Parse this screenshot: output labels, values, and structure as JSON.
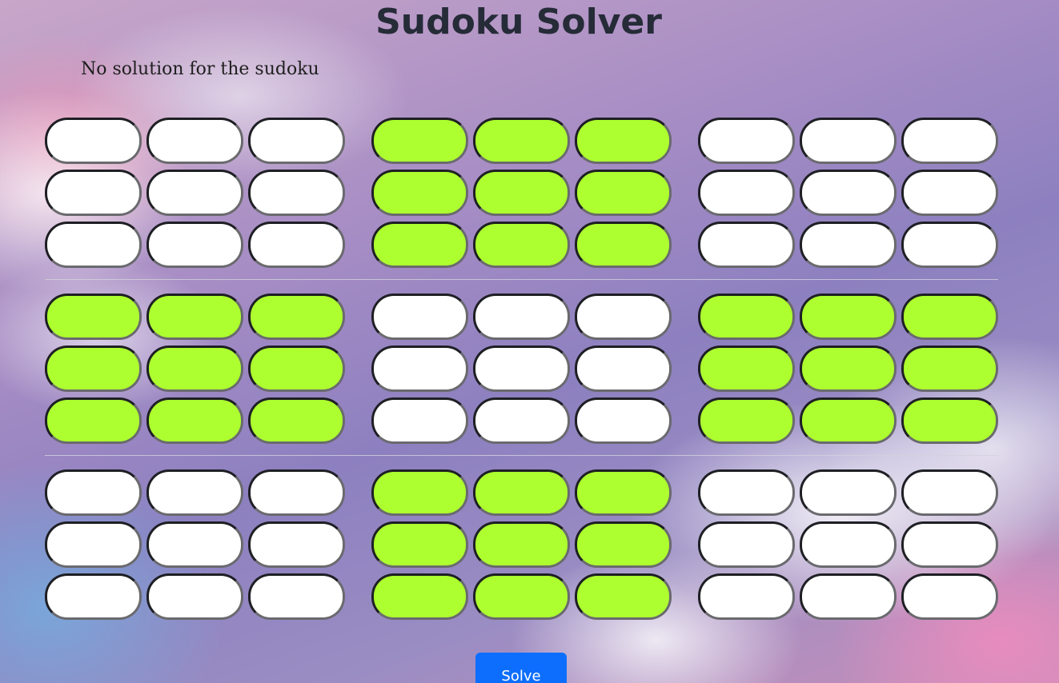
{
  "app": {
    "title": "Sudoku Solver",
    "message": "No solution for the sudoku"
  },
  "grid": {
    "highlight_color": "#adff2f",
    "cell_color": "#ffffff",
    "highlighted_boxes": [
      1,
      3,
      5,
      7
    ],
    "cells": [
      [
        "",
        "",
        "",
        "",
        "",
        "",
        "",
        "",
        ""
      ],
      [
        "",
        "",
        "",
        "",
        "",
        "",
        "",
        "",
        ""
      ],
      [
        "",
        "",
        "",
        "",
        "",
        "",
        "",
        "",
        ""
      ],
      [
        "",
        "",
        "",
        "",
        "",
        "",
        "",
        "",
        ""
      ],
      [
        "",
        "",
        "",
        "",
        "",
        "",
        "",
        "",
        ""
      ],
      [
        "",
        "",
        "",
        "",
        "",
        "",
        "",
        "",
        ""
      ],
      [
        "",
        "",
        "",
        "",
        "",
        "",
        "",
        "",
        ""
      ],
      [
        "",
        "",
        "",
        "",
        "",
        "",
        "",
        "",
        ""
      ],
      [
        "",
        "",
        "",
        "",
        "",
        "",
        "",
        "",
        ""
      ]
    ]
  },
  "actions": {
    "solve_label": "Solve",
    "solve_color": "#0d6efd"
  }
}
